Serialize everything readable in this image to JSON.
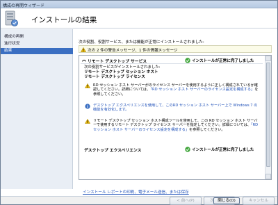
{
  "window": {
    "title": "構成の再開ウィザード"
  },
  "header": {
    "title": "インストールの結果",
    "icon": "server-wizard-icon"
  },
  "nav": {
    "items": [
      "構成の再開",
      "進行状況",
      "結果"
    ],
    "active_index": 2
  },
  "main": {
    "intro": "次の役割、役割サービス、または機能が正常にインストールされました:",
    "summary": "次の 2 件の警告メッセージ、1 件の情報メッセージ",
    "results": {
      "section1": {
        "title": "リモート デスクトップ サービス",
        "status": "インストールが正常に完了しました",
        "lines": [
          "次の役割サービスがインストールされました:",
          "リモート デスクトップ セッション ホスト",
          "リモート デスクトップ ライセンス"
        ],
        "messages": [
          {
            "type": "warning",
            "text": "RD セッション ホスト サーバーがのライセンス サーバーを使用するように正しく構成されているか確認してください。詳細については、",
            "link": "「RD セッション ホスト サーバーのライセンス設定を構成する」",
            "text_after": "を参照してください。"
          },
          {
            "type": "info",
            "text": "",
            "link": "デスクトップ エクスペリエンスを使用して、このRD セッション ホスト サーバー上で Windows 7 の機能を有効化します。",
            "text_after": ""
          },
          {
            "type": "warning",
            "text": "リモート デスクトップ セッション ホスト構成ツールを使用して、この RD セッション ホスト サーバーで使用するリモート デスクトップ ライセンス サーバーを指定してください。詳細については、",
            "link": "「RD セッション ホスト サーバーのライセンス設定を構成する」",
            "text_after": "を参照してください。"
          }
        ]
      },
      "section2": {
        "title": "デスクトップ エクスペリエンス",
        "status": "インストールが正常に完了しました"
      }
    }
  },
  "report_link": "インストール レポートの印刷、電子メール送信、または保存",
  "buttons": {
    "prev": "< 前へ(P)",
    "next": "次へ(N) >",
    "close": "閉じる(O)",
    "cancel": "キャンセル"
  },
  "colors": {
    "accent": "#3b6fc2",
    "link": "#1d4fb8",
    "highlight": "#e0221b",
    "success": "#3fa53a",
    "warning": "#e8b90c"
  }
}
